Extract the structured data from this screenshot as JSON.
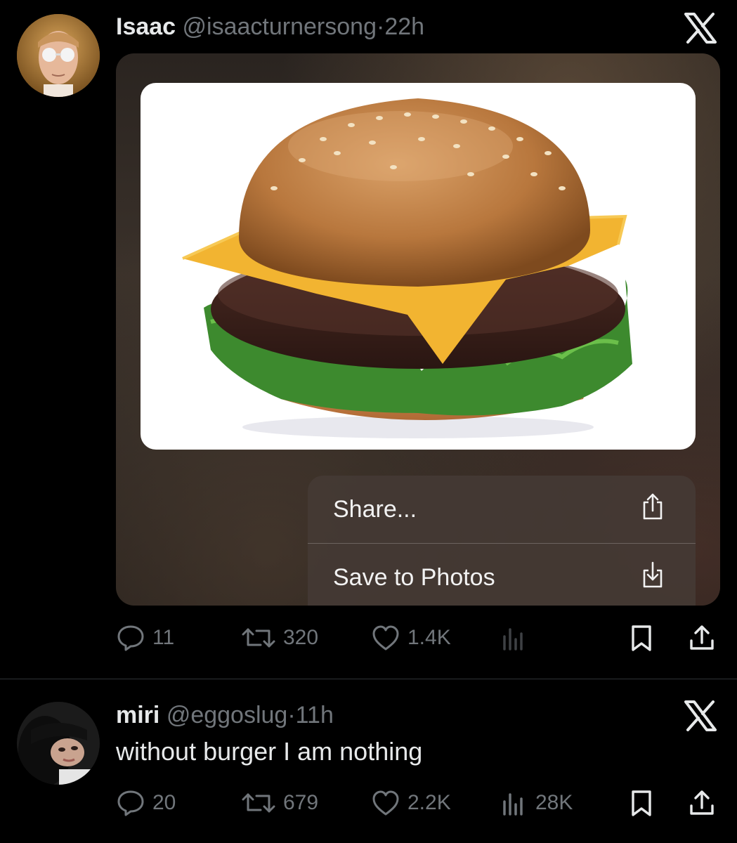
{
  "tweet1": {
    "name": "Isaac",
    "handle": "@isaacturnersong",
    "dot": "·",
    "time": "22h",
    "menu": {
      "share_label": "Share...",
      "save_label": "Save to Photos"
    },
    "stats": {
      "replies": "11",
      "reposts": "320",
      "likes": "1.4K",
      "views": ""
    }
  },
  "tweet2": {
    "name": "miri",
    "handle": "@eggoslug",
    "dot": "·",
    "time": "11h",
    "text": "without burger I am nothing",
    "stats": {
      "replies": "20",
      "reposts": "679",
      "likes": "2.2K",
      "views": "28K"
    }
  },
  "icons": {
    "reply": "reply-icon",
    "repost": "repost-icon",
    "like": "heart-icon",
    "views": "analytics-icon",
    "bookmark": "bookmark-icon",
    "share": "share-icon",
    "x_logo": "x-logo-icon"
  },
  "colors": {
    "background": "#000000",
    "primary_text": "#e7e9ea",
    "secondary_text": "#71767b",
    "menu_bg": "#443a34",
    "divider": "#2f3336"
  }
}
